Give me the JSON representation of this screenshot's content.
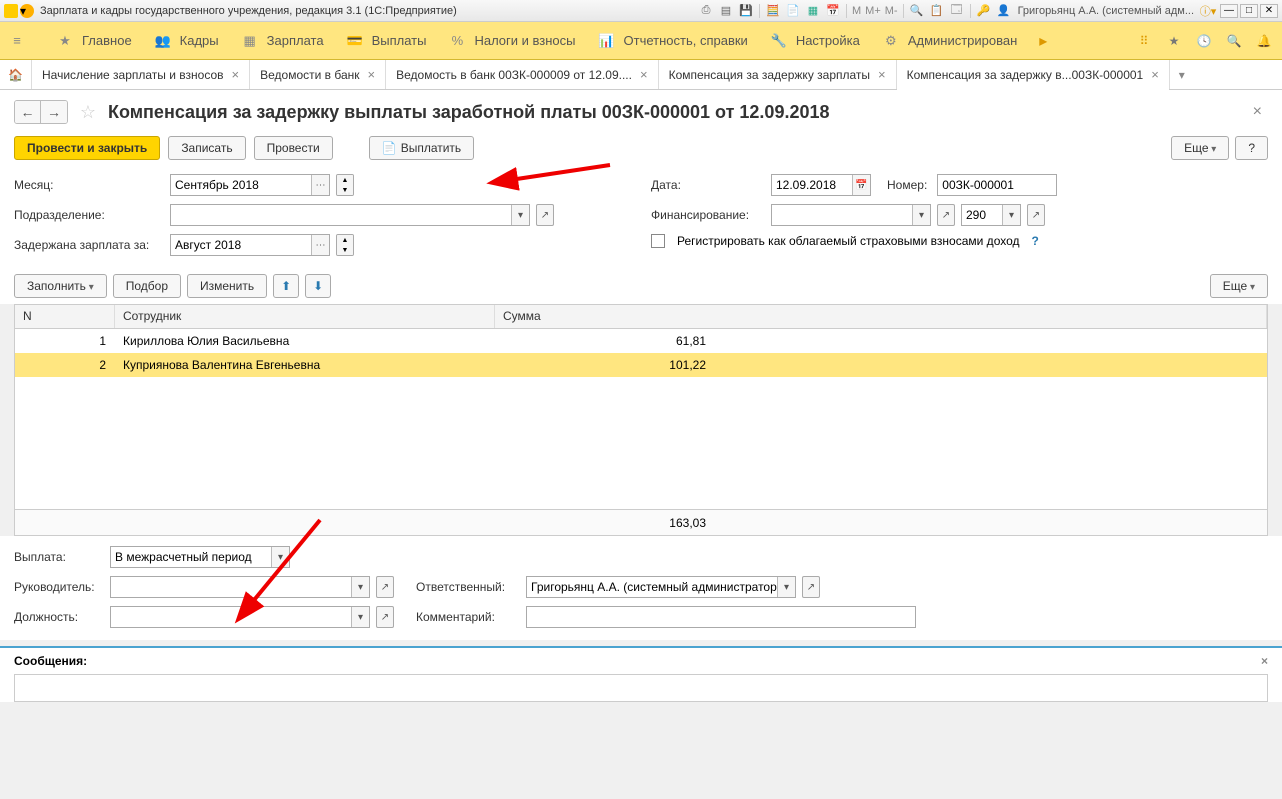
{
  "titlebar": {
    "title": "Зарплата и кадры государственного учреждения, редакция 3.1  (1С:Предприятие)",
    "m1": "М",
    "m2": "М+",
    "m3": "М-",
    "user": "Григорьянц А.А. (системный адм..."
  },
  "mainmenu": {
    "items": [
      "Главное",
      "Кадры",
      "Зарплата",
      "Выплаты",
      "Налоги и взносы",
      "Отчетность, справки",
      "Настройка",
      "Администрирован"
    ]
  },
  "tabs": [
    {
      "label": "Начисление зарплаты и взносов"
    },
    {
      "label": "Ведомости в банк"
    },
    {
      "label": "Ведомость в банк 00ЗК-000009 от 12.09...."
    },
    {
      "label": "Компенсация за задержку зарплаты"
    },
    {
      "label": "Компенсация за задержку в...00ЗК-000001",
      "active": true
    }
  ],
  "form": {
    "title": "Компенсация за задержку выплаты заработной платы 00ЗК-000001 от 12.09.2018",
    "btn_post_close": "Провести и закрыть",
    "btn_save": "Записать",
    "btn_post": "Провести",
    "btn_pay": "Выплатить",
    "btn_more": "Еще",
    "btn_help": "?",
    "month_label": "Месяц:",
    "month_value": "Сентябрь 2018",
    "dept_label": "Подразделение:",
    "delayed_label": "Задержана зарплата за:",
    "delayed_value": "Август 2018",
    "date_label": "Дата:",
    "date_value": "12.09.2018",
    "number_label": "Номер:",
    "number_value": "00ЗК-000001",
    "fin_label": "Финансирование:",
    "fin2_value": "290",
    "reg_label": "Регистрировать как облагаемый страховыми взносами доход",
    "btn_fill": "Заполнить",
    "btn_pick": "Подбор",
    "btn_edit": "Изменить",
    "col_n": "N",
    "col_emp": "Сотрудник",
    "col_sum": "Сумма",
    "rows": [
      {
        "n": "1",
        "emp": "Кириллова Юлия Васильевна",
        "sum": "61,81"
      },
      {
        "n": "2",
        "emp": "Куприянова Валентина Евгеньевна",
        "sum": "101,22"
      }
    ],
    "total": "163,03",
    "payout_label": "Выплата:",
    "payout_value": "В межрасчетный период",
    "mgr_label": "Руководитель:",
    "resp_label": "Ответственный:",
    "resp_value": "Григорьянц А.А. (системный администратор",
    "pos_label": "Должность:",
    "comm_label": "Комментарий:",
    "messages": "Сообщения:"
  }
}
